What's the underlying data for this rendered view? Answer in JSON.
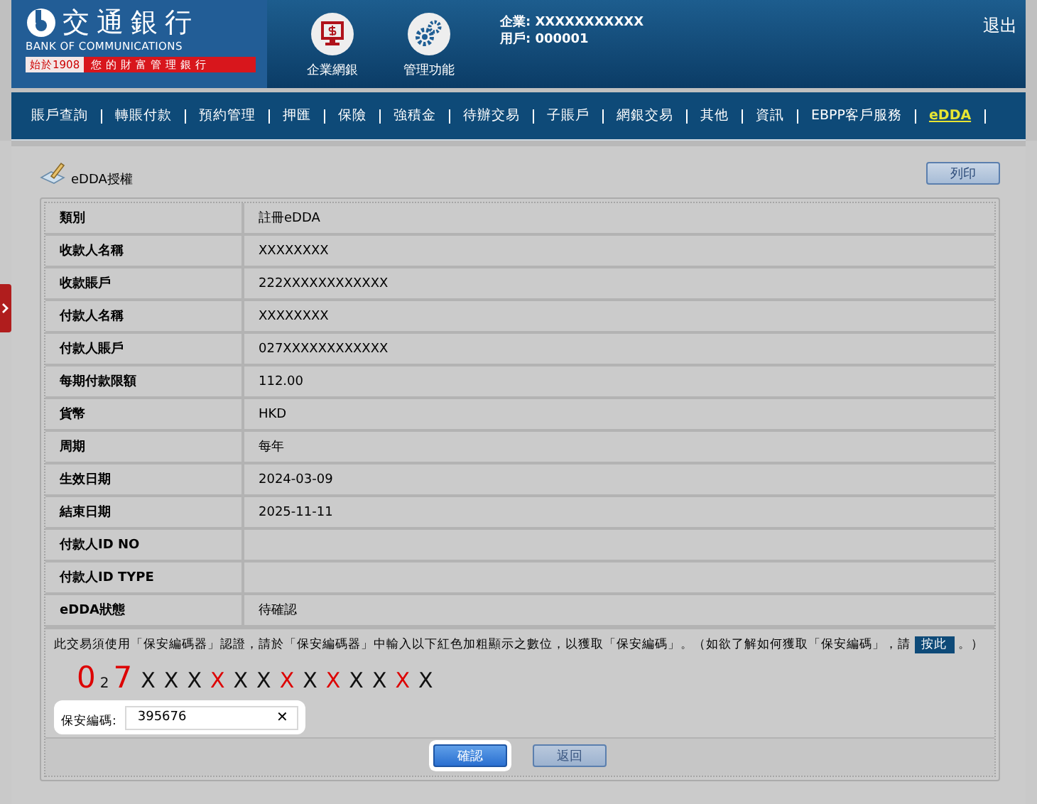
{
  "header": {
    "bank_name": "交通銀行",
    "bank_name_en": "BANK OF COMMUNICATIONS",
    "since": "始於1908",
    "slogan": "您的財富管理銀行",
    "shortcuts": [
      {
        "label": "企業網銀",
        "kind": "monitor"
      },
      {
        "label": "管理功能",
        "kind": "gears"
      }
    ],
    "company": "企業: XXXXXXXXXXX",
    "user": "用戶: 000001",
    "logout": "退出"
  },
  "nav": [
    {
      "label": "賬戶查詢",
      "selected": false
    },
    {
      "label": "轉賬付款",
      "selected": false
    },
    {
      "label": "預約管理",
      "selected": false
    },
    {
      "label": "押匯",
      "selected": false
    },
    {
      "label": "保險",
      "selected": false
    },
    {
      "label": "強積金",
      "selected": false
    },
    {
      "label": "待辦交易",
      "selected": false
    },
    {
      "label": "子賬戶",
      "selected": false
    },
    {
      "label": "網銀交易",
      "selected": false
    },
    {
      "label": "其他",
      "selected": false
    },
    {
      "label": "資訊",
      "selected": false
    },
    {
      "label": "EBPP客戶服務",
      "selected": false
    },
    {
      "label": "eDDA",
      "selected": true
    }
  ],
  "page_title": "eDDA授權",
  "print_button": "列印",
  "rows": [
    {
      "label": "類別",
      "value": "註冊eDDA"
    },
    {
      "label": "收款人名稱",
      "value": "XXXXXXXX"
    },
    {
      "label": "收款賬戶",
      "value": "222XXXXXXXXXXXX"
    },
    {
      "label": "付款人名稱",
      "value": "XXXXXXXX"
    },
    {
      "label": "付款人賬戶",
      "value": "027XXXXXXXXXXXX"
    },
    {
      "label": "每期付款限額",
      "value": "112.00"
    },
    {
      "label": "貨幣",
      "value": "HKD"
    },
    {
      "label": "周期",
      "value": "每年"
    },
    {
      "label": "生效日期",
      "value": "2024-03-09"
    },
    {
      "label": "結束日期",
      "value": "2025-11-11"
    },
    {
      "label": "付款人ID NO"
    },
    {
      "label": "付款人ID TYPE"
    },
    {
      "label": "eDDA狀態",
      "value": "待確認"
    }
  ],
  "instruction": "此交易須使用「保安編碼器」認證，請於「保安編碼器」中輸入以下紅色加粗顯示之數位，以獲取「保安編碼」。（如欲了解如何獲取「保安編碼」，請",
  "help_link": "按此",
  "instruction_end": "。）",
  "challenge": [
    {
      "char": "0",
      "kind": "bold-red"
    },
    {
      "char": "2",
      "kind": "small"
    },
    {
      "char": "7",
      "kind": "bold-red"
    },
    {
      "char": "X",
      "kind": "plain"
    },
    {
      "char": "X",
      "kind": "plain"
    },
    {
      "char": "X",
      "kind": "plain"
    },
    {
      "char": "X",
      "kind": "red"
    },
    {
      "char": "X",
      "kind": "plain"
    },
    {
      "char": "X",
      "kind": "plain"
    },
    {
      "char": "X",
      "kind": "red"
    },
    {
      "char": "X",
      "kind": "plain"
    },
    {
      "char": "X",
      "kind": "red"
    },
    {
      "char": "X",
      "kind": "plain"
    },
    {
      "char": "X",
      "kind": "plain"
    },
    {
      "char": "X",
      "kind": "red"
    },
    {
      "char": "X",
      "kind": "plain"
    }
  ],
  "security_code": {
    "label": "保安編碼:",
    "value": "395676",
    "clear": "✕"
  },
  "buttons": [
    {
      "label": "確認",
      "kind": "primary"
    },
    {
      "label": "返回",
      "kind": "secondary"
    }
  ]
}
